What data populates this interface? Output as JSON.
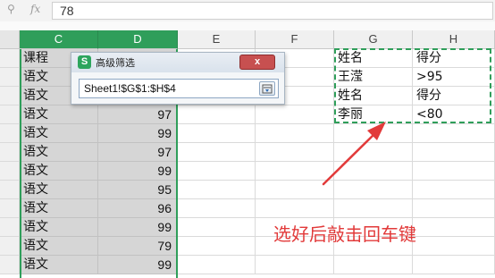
{
  "formula_bar": {
    "value": "78",
    "zoom_icon": "magnifier-icon",
    "fx_label": "fx"
  },
  "columns": {
    "C": "C",
    "D": "D",
    "E": "E",
    "F": "F",
    "G": "G",
    "H": "H"
  },
  "col_c": [
    "课程",
    "语文",
    "语文",
    "语文",
    "语文",
    "语文",
    "语文",
    "语文",
    "语文",
    "语文",
    "语文",
    "语文"
  ],
  "col_d": [
    "",
    "",
    "",
    "97",
    "99",
    "97",
    "99",
    "95",
    "96",
    "99",
    "79",
    "99"
  ],
  "criteria": {
    "g": [
      "姓名",
      "王滢",
      "姓名",
      "李丽"
    ],
    "h": [
      "得分",
      ">95",
      "得分",
      "<80"
    ]
  },
  "dialog": {
    "title": "高级筛选",
    "app_icon_letter": "S",
    "close_label": "x",
    "range_value": "Sheet1!$G$1:$H$4"
  },
  "annotation": {
    "text": "选好后敲击回车键",
    "color": "#e23a3a"
  },
  "colors": {
    "selection_green": "#2f9e5a",
    "selected_cell_bg": "#d6d6d6"
  }
}
